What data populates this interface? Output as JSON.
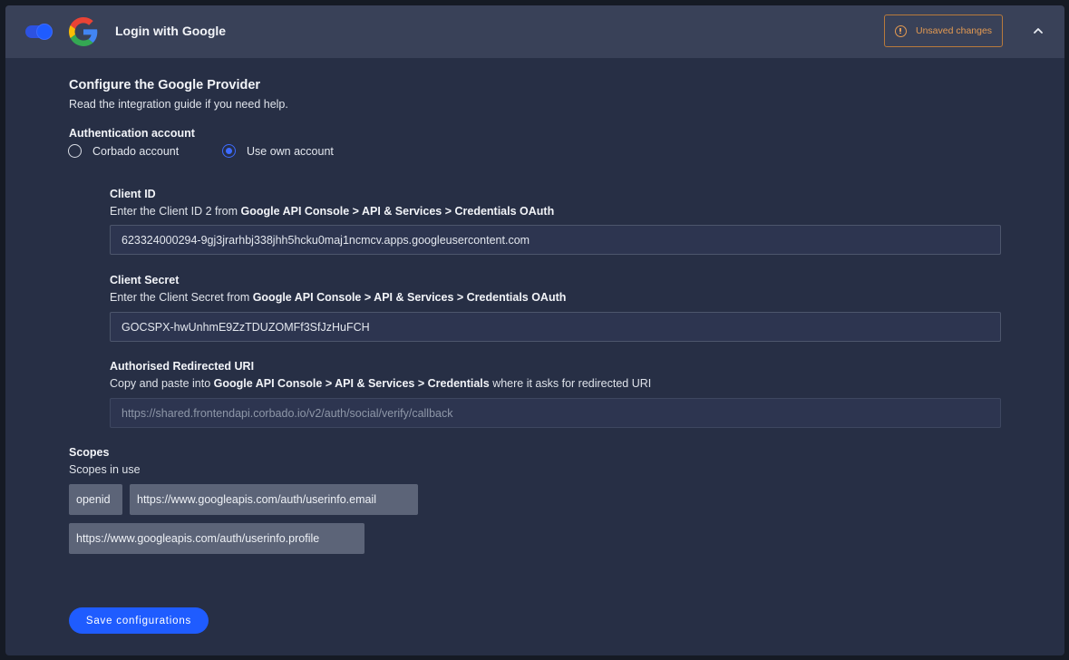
{
  "header": {
    "title": "Login with Google",
    "unsaved_label": "Unsaved changes",
    "toggle_on": true
  },
  "provider": {
    "title": "Configure the Google Provider",
    "subtitle": "Read the integration guide if you need help."
  },
  "auth": {
    "label": "Authentication account",
    "options": [
      {
        "label": "Corbado account",
        "selected": false
      },
      {
        "label": "Use own account",
        "selected": true
      }
    ]
  },
  "fields": {
    "client_id": {
      "label": "Client ID",
      "help_prefix": "Enter the Client ID 2 from ",
      "help_bold": "Google API Console > API & Services > Credentials OAuth",
      "help_suffix": "",
      "value": "623324000294-9gj3jrarhbj338jhh5hcku0maj1ncmcv.apps.googleusercontent.com"
    },
    "client_secret": {
      "label": "Client Secret",
      "help_prefix": "Enter the Client Secret from ",
      "help_bold": "Google API Console > API & Services > Credentials OAuth",
      "help_suffix": "",
      "value": "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"
    },
    "redirect_uri": {
      "label": "Authorised Redirected URI",
      "help_prefix": "Copy and paste into ",
      "help_bold": "Google API Console > API & Services > Credentials",
      "help_suffix": " where it asks for redirected URI",
      "value": "https://shared.frontendapi.corbado.io/v2/auth/social/verify/callback"
    }
  },
  "scopes": {
    "label": "Scopes",
    "subtitle": "Scopes in use",
    "items": [
      "openid",
      "https://www.googleapis.com/auth/userinfo.email",
      "https://www.googleapis.com/auth/userinfo.profile"
    ]
  },
  "save_label": "Save configurations",
  "colors": {
    "accent": "#1f5cff",
    "warning": "#e49a52",
    "panel": "#272f45",
    "header": "#394158"
  }
}
